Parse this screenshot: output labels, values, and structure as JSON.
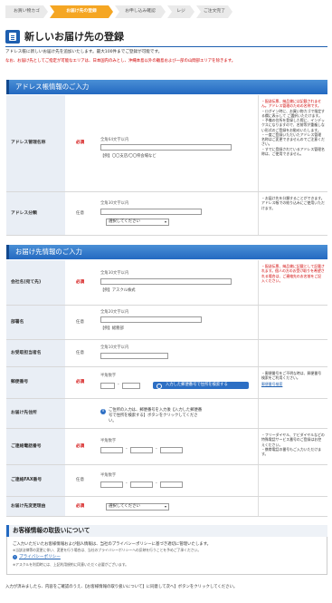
{
  "steps": [
    "お買い物カゴ",
    "お届け先の登録",
    "お申し込み確認",
    "レジ",
    "ご注文完了"
  ],
  "page_title": "新しいお届け先の登録",
  "intro": "アドレス帳に新しいお届け先を追加いたします。最大100件までご登録が可能です。",
  "warning": "なお、お届け先としてご指定が可能なエリアは、日本国内のみとし、沖縄本島以外の離島および一部の山間部エリアを除きます。",
  "address_section": {
    "title": "アドレス帳情報のご入力",
    "name_row": {
      "label": "アドレス管理名称",
      "req": "必須",
      "hint": "全角64文字以内",
      "example": "【例】〇〇支店/〇〇県会場など",
      "note": [
        "・配送伝票、納品書には記載されません。アドレス管理のための名称です。",
        "・ログイン時に、お買い物カゴで指定する欄に表示して ご選択いただけます。",
        "・予備の住所を登録した際に、インデックスになりますので、名前等が重複しない形式のご登録をお勧めいたします。",
        "・一度ご登録いただいたアドレス管理名称はご変更できませんのでご注意ください。",
        "・すでに登録されているアドレス管理名称は、ご使用できません。"
      ]
    },
    "group_row": {
      "label": "アドレス分類",
      "req": "任意",
      "hint": "全角30文字以内",
      "select": "選択してください",
      "note": [
        "・お届け先を分類することができます。アドレス帳での絞り込みにご使用いただけます。"
      ]
    }
  },
  "delivery_section": {
    "title": "お届け先情報のご入力",
    "company": {
      "label": "会社名(宛て先)",
      "req": "必須",
      "hint": "全角30文字以内",
      "example": "【例】アスクル株式",
      "note": [
        "・配送伝票、納品書に記載として記載されます。個人の方のお受け取りを希望される場合は、ご連絡先のお名前をご記入ください。"
      ]
    },
    "department": {
      "label": "部署名",
      "req": "任意",
      "hint": "全角20文字以内",
      "example": "【例】総務部"
    },
    "recipient": {
      "label": "お受取担当者名",
      "req": "任意",
      "hint": "全角10文字以内"
    },
    "zip": {
      "label": "郵便番号",
      "req": "必須",
      "hint": "半角数字",
      "button": "入力した郵便番号で住所を検索する",
      "note": [
        "・郵便番号をご不明な時は、郵便番号検索をご利用ください。"
      ],
      "link": "郵便番号検索"
    },
    "address": {
      "label": "お届け先住所",
      "req": "",
      "info": "ご住所の入力は、郵便番号を入力後【入力した郵便番号で住所を検索する】ボタンをクリックしてください。"
    },
    "phone": {
      "label": "ご連絡電話番号",
      "req": "必須",
      "hint": "半角数字",
      "note": [
        "・フリーダイヤル、ナビダイヤルなどの特殊電話サービス番号のご登録はお控えください。",
        "・携帯電話の番号もご入力いただけます。"
      ]
    },
    "fax": {
      "label": "ご連絡FAX番号",
      "req": "任意",
      "hint": "半角数字"
    },
    "reason": {
      "label": "お届け先変更理由",
      "req": "必須",
      "select": "選択してください"
    }
  },
  "privacy": {
    "title": "お客様情報の取扱いについて",
    "body": "ご入力いただいたお客様情報および個人情報は、当社のプライバシーポリシーに基づき適切に管理いたします。",
    "sub": "※当該法律等の変更に伴い、変更を行う場合は、当社のプライバシーポリシーへの反映を行うことを予めご了承ください。",
    "link": "プライバシーポリシー",
    "small": "※アスクルを利用時には、上記利用規約に同意いただく必要がございます。"
  },
  "footer": "入力が済みましたら、内容をご確認のうえ、【お客様情報の取り扱いについて】に同意して次へ】ボタンをクリックしてください。"
}
